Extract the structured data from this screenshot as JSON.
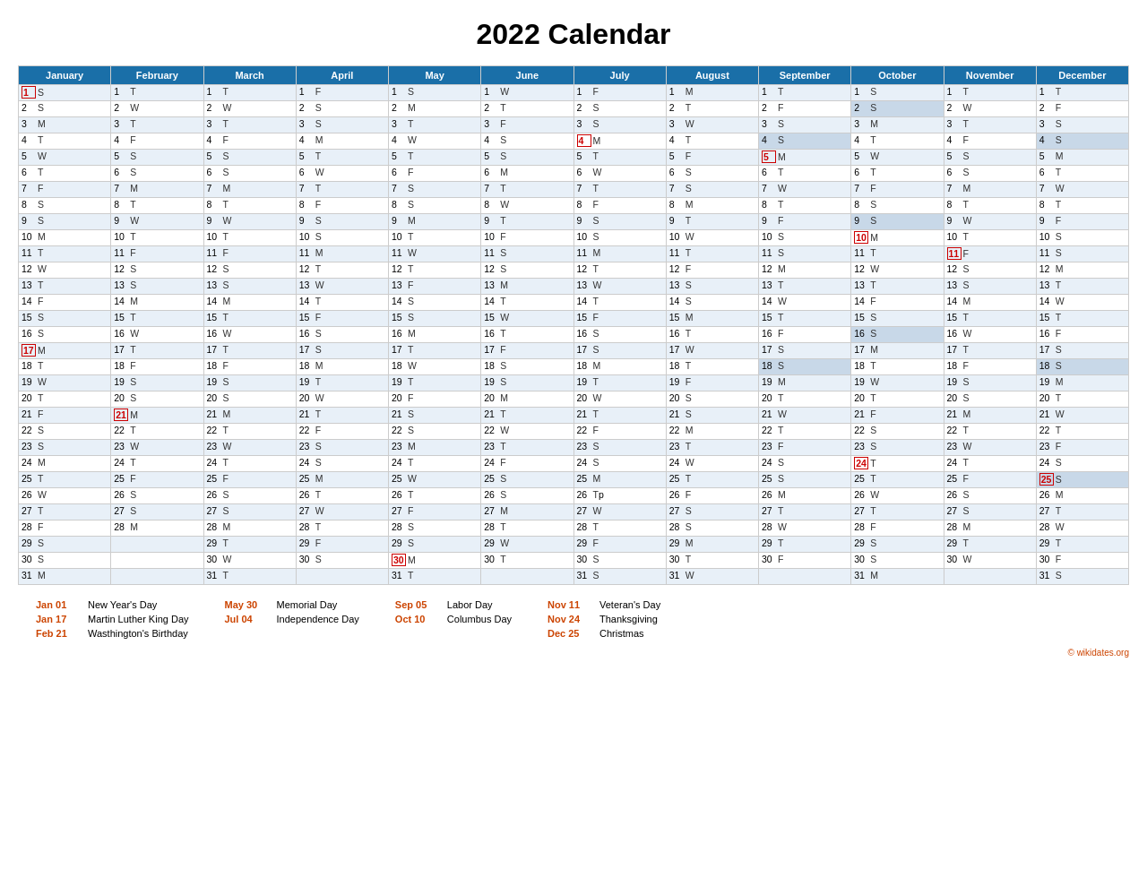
{
  "title": "2022 Calendar",
  "months": [
    "January",
    "February",
    "March",
    "April",
    "May",
    "June",
    "July",
    "August",
    "September",
    "October",
    "November",
    "December"
  ],
  "holidays": [
    {
      "date": "Jan 01",
      "name": "New Year's Day"
    },
    {
      "date": "Jan 17",
      "name": "Martin Luther King Day"
    },
    {
      "date": "Feb 21",
      "name": "Wasthington's Birthday"
    },
    {
      "date": "May 30",
      "name": "Memorial Day"
    },
    {
      "date": "Jul 04",
      "name": "Independence Day"
    },
    {
      "date": "Sep 05",
      "name": "Labor Day"
    },
    {
      "date": "Oct 10",
      "name": "Columbus Day"
    },
    {
      "date": "Nov 11",
      "name": "Veteran's Day"
    },
    {
      "date": "Nov 24",
      "name": "Thanksgiving"
    },
    {
      "date": "Dec 25",
      "name": "Christmas"
    }
  ],
  "footer": "© wikidates.org"
}
